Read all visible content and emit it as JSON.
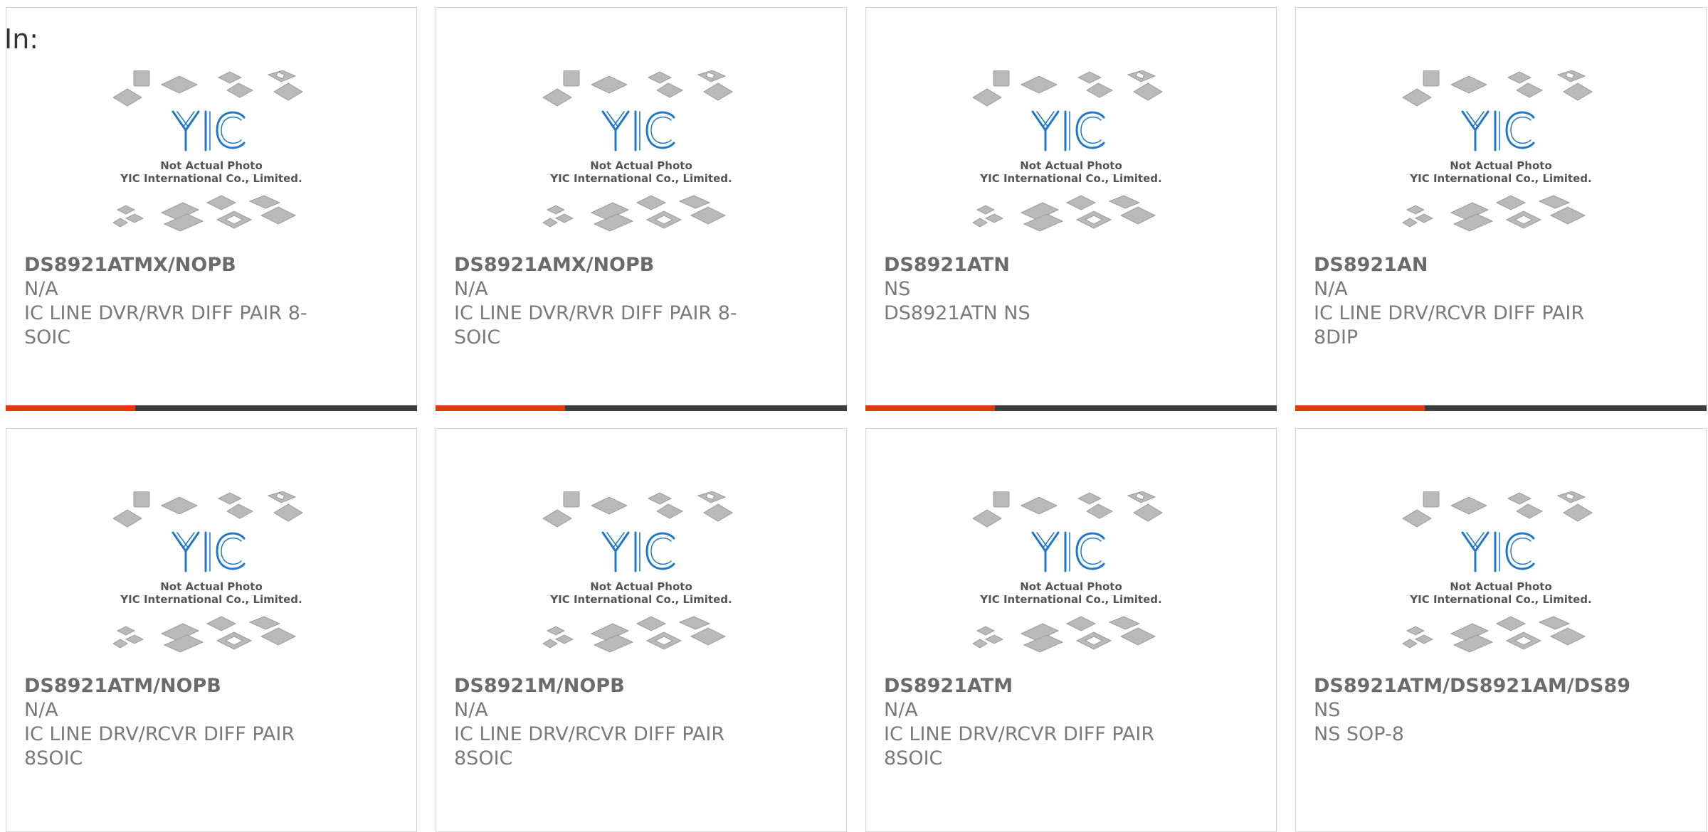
{
  "page": {
    "heading": "In:"
  },
  "placeholder": {
    "logo_text": "YIC",
    "line1": "Not Actual Photo",
    "line2": "YIC International Co., Limited."
  },
  "colors": {
    "accent": "#e4380c",
    "bar": "#3d3d3d",
    "logo": "#1f77c9",
    "text": "#7a7a7a"
  },
  "products": [
    {
      "part_number": "DS8921ATMX/NOPB",
      "manufacturer": "N/A",
      "description": "IC LINE DVR/RVR DIFF PAIR 8-SOIC"
    },
    {
      "part_number": "DS8921AMX/NOPB",
      "manufacturer": "N/A",
      "description": "IC LINE DVR/RVR DIFF PAIR 8-SOIC"
    },
    {
      "part_number": "DS8921ATN",
      "manufacturer": "NS",
      "description": "DS8921ATN NS"
    },
    {
      "part_number": "DS8921AN",
      "manufacturer": "N/A",
      "description": "IC LINE DRV/RCVR DIFF PAIR 8DIP"
    },
    {
      "part_number": "DS8921ATM/NOPB",
      "manufacturer": "N/A",
      "description": "IC LINE DRV/RCVR DIFF PAIR 8SOIC"
    },
    {
      "part_number": "DS8921M/NOPB",
      "manufacturer": "N/A",
      "description": "IC LINE DRV/RCVR DIFF PAIR 8SOIC"
    },
    {
      "part_number": "DS8921ATM",
      "manufacturer": "N/A",
      "description": "IC LINE DRV/RCVR DIFF PAIR 8SOIC"
    },
    {
      "part_number": "DS8921ATM/DS8921AM/DS89",
      "manufacturer": "NS",
      "description": "NS SOP-8"
    }
  ]
}
